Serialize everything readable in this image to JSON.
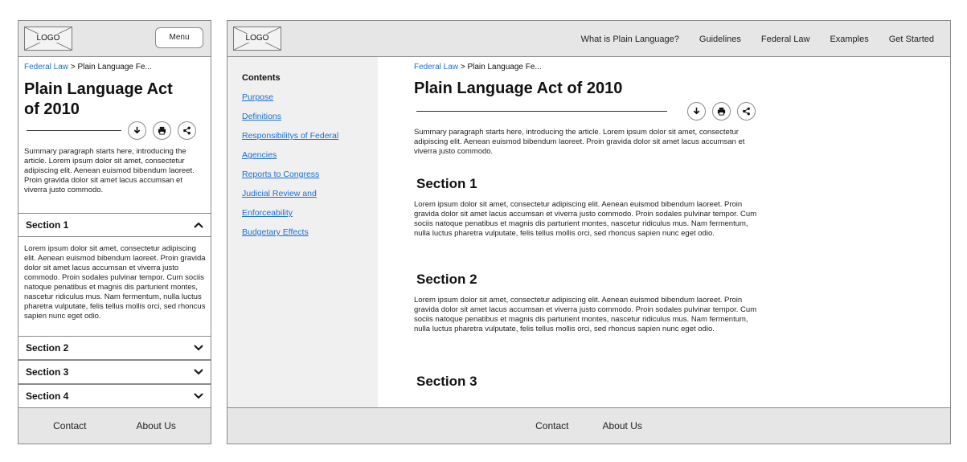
{
  "logo_text": "LOGO",
  "breadcrumb": {
    "parent": "Federal Law",
    "separator": ">",
    "current": "Plain Language Fe..."
  },
  "article": {
    "title": "Plain Language Act of 2010",
    "title_mobile_line1": "Plain Language Act",
    "title_mobile_line2": "of 2010",
    "summary": "Summary paragraph starts here, introducing the article. Lorem ipsum dolor sit amet, consectetur adipiscing elit. Aenean euismod bibendum laoreet. Proin gravida dolor sit amet lacus accumsan et viverra justo commodo."
  },
  "tools": [
    {
      "icon": "download-icon"
    },
    {
      "icon": "print-icon"
    },
    {
      "icon": "share-icon"
    }
  ],
  "mobile": {
    "menu_label": "Menu",
    "accordion": [
      {
        "label": "Section 1",
        "expanded": true,
        "icon": "chevron-up-icon"
      },
      {
        "label": "Section 2",
        "expanded": false,
        "icon": "chevron-down-icon"
      },
      {
        "label": "Section 3",
        "expanded": false,
        "icon": "chevron-down-icon"
      },
      {
        "label": "Section 4",
        "expanded": false,
        "icon": "chevron-down-icon"
      }
    ],
    "section1_text": "Lorem ipsum dolor sit amet, consectetur adipiscing elit. Aenean euismod bibendum laoreet. Proin gravida dolor sit amet lacus accumsan et viverra justo commodo. Proin sodales pulvinar tempor. Cum sociis natoque penatibus et magnis dis parturient montes, nascetur ridiculus mus. Nam fermentum, nulla luctus pharetra vulputate, felis tellus mollis orci, sed rhoncus sapien nunc eget odio."
  },
  "desktop": {
    "nav": [
      "What is Plain Language?",
      "Guidelines",
      "Federal Law",
      "Examples",
      "Get Started"
    ],
    "contents_title": "Contents",
    "toc": [
      "Purpose",
      "Definitions",
      "Responsibilitys of Federal",
      "Agencies",
      "Reports to Congress",
      "Judicial Review and",
      "Enforceability",
      "Budgetary Effects"
    ],
    "sections": [
      {
        "heading": "Section 1",
        "text": "Lorem ipsum dolor sit amet, consectetur adipiscing elit. Aenean euismod bibendum laoreet. Proin gravida dolor sit amet lacus accumsan et viverra justo commodo. Proin sodales pulvinar tempor. Cum sociis natoque penatibus et magnis dis parturient montes, nascetur ridiculus mus. Nam fermentum, nulla luctus pharetra vulputate, felis tellus mollis orci, sed rhoncus sapien nunc eget odio."
      },
      {
        "heading": "Section 2",
        "text": "Lorem ipsum dolor sit amet, consectetur adipiscing elit. Aenean euismod bibendum laoreet. Proin gravida dolor sit amet lacus accumsan et viverra justo commodo. Proin sodales pulvinar tempor. Cum sociis natoque penatibus et magnis dis parturient montes, nascetur ridiculus mus. Nam fermentum, nulla luctus pharetra vulputate, felis tellus mollis orci, sed rhoncus sapien nunc eget odio."
      },
      {
        "heading": "Section 3"
      }
    ]
  },
  "footer": {
    "contact": "Contact",
    "about": "About Us"
  },
  "colors": {
    "link": "#1a6fd6",
    "bar": "#e6e6e6",
    "sidebar": "#f0f0f0",
    "border": "#8a8a8a"
  }
}
